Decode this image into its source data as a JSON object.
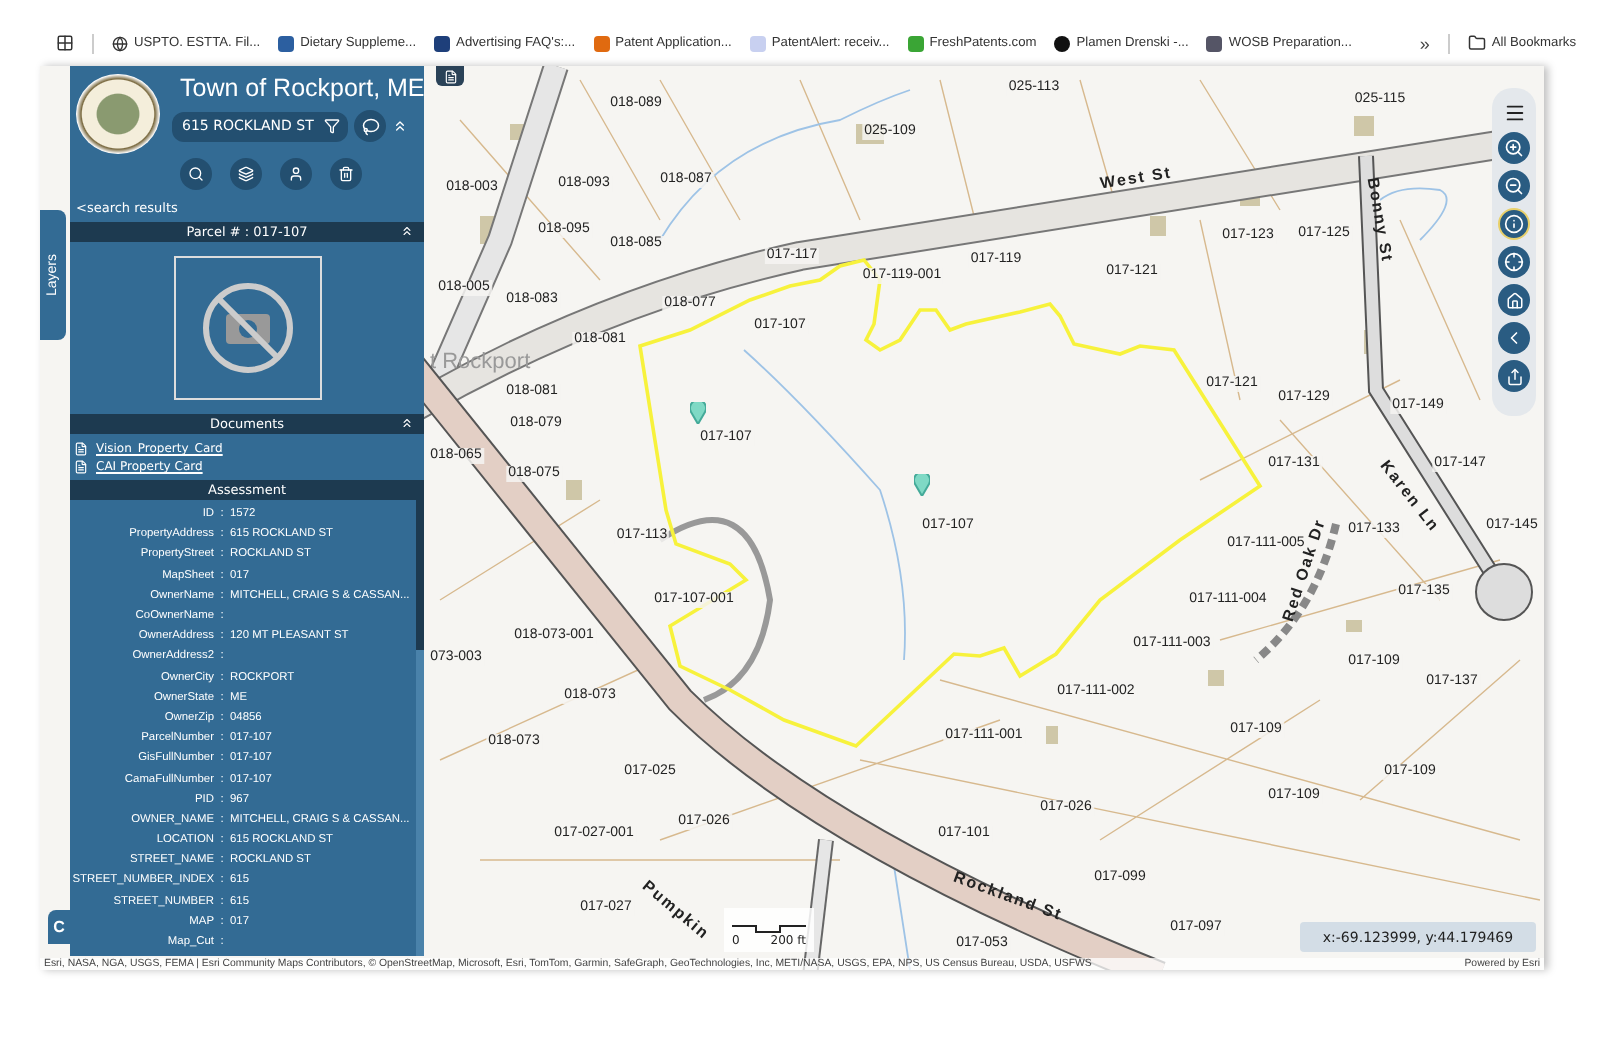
{
  "bookmarks": [
    {
      "label": "USPTO. ESTTA. Fil...",
      "kind": "globe"
    },
    {
      "label": "Dietary Suppleme...",
      "kind": "fda"
    },
    {
      "label": "Advertising FAQ's:...",
      "kind": "ftc"
    },
    {
      "label": "Patent Application...",
      "kind": "orange"
    },
    {
      "label": "PatentAlert: receiv...",
      "kind": "check"
    },
    {
      "label": "FreshPatents.com",
      "kind": "fp"
    },
    {
      "label": "Plamen Drenski -...",
      "kind": "dark"
    },
    {
      "label": "WOSB Preparation...",
      "kind": "sba"
    }
  ],
  "bookmarks_more": "»",
  "all_bookmarks": "All Bookmarks",
  "panel": {
    "title": "Town of Rockport, ME",
    "address": "615 ROCKLAND ST",
    "back_link": "<search results",
    "parcel_header": "Parcel # : 017-107",
    "documents_header": "Documents",
    "documents": [
      "Vision_Property_Card",
      "CAI Property Card"
    ],
    "assessment_header": "Assessment",
    "assessment": [
      {
        "field": "ID",
        "separator": ":",
        "value": "1572"
      },
      {
        "field": "PropertyAddress",
        "separator": ":",
        "value": "615 ROCKLAND ST"
      },
      {
        "field": "PropertyStreet",
        "separator": ":",
        "value": "ROCKLAND ST"
      },
      {
        "field": "MapSheet",
        "separator": ":",
        "value": "017"
      },
      {
        "field": "OwnerName",
        "separator": ":",
        "value": "MITCHELL, CRAIG S & CASSAN..."
      },
      {
        "field": "CoOwnerName",
        "separator": ":"
      },
      {
        "field": "OwnerAddress",
        "separator": ":",
        "value": "120 MT PLEASANT ST"
      },
      {
        "field": "OwnerAddress2",
        "separator": ":"
      },
      {
        "field": "OwnerCity",
        "separator": ":",
        "value": "ROCKPORT"
      },
      {
        "field": "OwnerState",
        "separator": ":",
        "value": "ME"
      },
      {
        "field": "OwnerZip",
        "separator": ":",
        "value": "04856"
      },
      {
        "field": "ParcelNumber",
        "separator": ":",
        "value": "017-107"
      },
      {
        "field": "GisFullNumber",
        "separator": ":",
        "value": "017-107"
      },
      {
        "field": "CamaFullNumber",
        "separator": ":",
        "value": "017-107"
      },
      {
        "field": "PID",
        "separator": ":",
        "value": "967"
      },
      {
        "field": "OWNER_NAME",
        "separator": ":",
        "value": "MITCHELL, CRAIG S & CASSAN..."
      },
      {
        "field": "LOCATION",
        "separator": ":",
        "value": "615 ROCKLAND ST"
      },
      {
        "field": "STREET_NAME",
        "separator": ":",
        "value": "ROCKLAND ST"
      },
      {
        "field": "STREET_NUMBER_INDEX",
        "separator": ":",
        "value": "615"
      },
      {
        "field": "STREET_NUMBER",
        "separator": ":",
        "value": "615"
      },
      {
        "field": "MAP",
        "separator": ":",
        "value": "017"
      },
      {
        "field": "Map_Cut",
        "separator": ":"
      }
    ]
  },
  "layers_tab": "Layers",
  "corner_button": "C",
  "map": {
    "parcels": [
      "018-089",
      "025-113",
      "025-115",
      "025-109",
      "018-003",
      "018-093",
      "018-087",
      "018-095",
      "018-085",
      "017-123",
      "017-125",
      "018-005",
      "018-083",
      "017-117",
      "017-119-001",
      "017-119",
      "017-121",
      "018-077",
      "017-107",
      "018-081",
      "017-121",
      "017-129",
      "017-149",
      "018-081",
      "018-079",
      "017-107",
      "018-065",
      "017-131",
      "017-147",
      "018-075",
      "017-107",
      "017-113",
      "017-111-005",
      "017-133",
      "017-145",
      "017-107-001",
      "017-111-004",
      "017-135",
      "018-073-001",
      "073-003",
      "017-111-003",
      "017-109",
      "017-137",
      "018-073",
      "017-111-002",
      "017-109",
      "018-073",
      "017-111-001",
      "017-025",
      "017-109",
      "017-109",
      "017-026",
      "017-027-001",
      "017-026",
      "017-101",
      "017-099",
      "017-027",
      "017-097",
      "017-053"
    ],
    "streets": [
      "West St",
      "Bonny St",
      "Karen Ln",
      "Red Oak Dr",
      "Rockland St",
      "Pumpkin",
      "t Rockport"
    ],
    "scale": {
      "start": "0",
      "end": "200 ft"
    },
    "coordinates": "x:-69.123999, y:44.179469",
    "attribution": "Esri, NASA, NGA, USGS, FEMA | Esri Community Maps Contributors, © OpenStreetMap, Microsoft, Esri, TomTom, Garmin, SafeGraph, GeoTechnologies, Inc, METI/NASA, USGS, EPA, NPS, US Census Bureau, USDA, USFWS",
    "powered_by": "Powered by Esri"
  }
}
